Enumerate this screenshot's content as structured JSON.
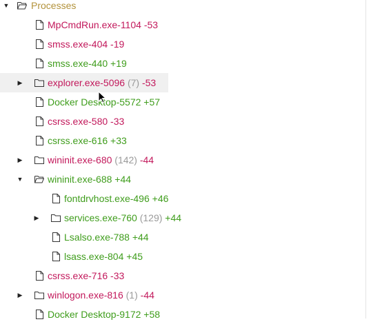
{
  "tree": {
    "root": {
      "label": "Processes",
      "expanded": true
    },
    "rows": [
      {
        "name": "MpCmdRun.exe-1104",
        "count": "",
        "delta": "-53",
        "type": "file",
        "depth": 1,
        "twisty": "",
        "color": "red"
      },
      {
        "name": "smss.exe-404",
        "count": "",
        "delta": "-19",
        "type": "file",
        "depth": 1,
        "twisty": "",
        "color": "red"
      },
      {
        "name": "smss.exe-440",
        "count": "",
        "delta": "+19",
        "type": "file",
        "depth": 1,
        "twisty": "",
        "color": "green"
      },
      {
        "name": "explorer.exe-5096",
        "count": "(7)",
        "delta": "-53",
        "type": "folder",
        "depth": 1,
        "twisty": "collapsed",
        "color": "red",
        "hover": true
      },
      {
        "name": "Docker Desktop-5572",
        "count": "",
        "delta": "+57",
        "type": "file",
        "depth": 1,
        "twisty": "",
        "color": "green"
      },
      {
        "name": "csrss.exe-580",
        "count": "",
        "delta": "-33",
        "type": "file",
        "depth": 1,
        "twisty": "",
        "color": "red"
      },
      {
        "name": "csrss.exe-616",
        "count": "",
        "delta": "+33",
        "type": "file",
        "depth": 1,
        "twisty": "",
        "color": "green"
      },
      {
        "name": "wininit.exe-680",
        "count": "(142)",
        "delta": "-44",
        "type": "folder",
        "depth": 1,
        "twisty": "collapsed",
        "color": "red"
      },
      {
        "name": "wininit.exe-688",
        "count": "",
        "delta": "+44",
        "type": "folder-open",
        "depth": 1,
        "twisty": "expanded",
        "color": "green"
      },
      {
        "name": "fontdrvhost.exe-496",
        "count": "",
        "delta": "+46",
        "type": "file",
        "depth": 2,
        "twisty": "",
        "color": "green"
      },
      {
        "name": "services.exe-760",
        "count": "(129)",
        "delta": "+44",
        "type": "folder",
        "depth": 2,
        "twisty": "collapsed",
        "color": "green"
      },
      {
        "name": "Lsalso.exe-788",
        "count": "",
        "delta": "+44",
        "type": "file",
        "depth": 2,
        "twisty": "",
        "color": "green"
      },
      {
        "name": "lsass.exe-804",
        "count": "",
        "delta": "+45",
        "type": "file",
        "depth": 2,
        "twisty": "",
        "color": "green"
      },
      {
        "name": "csrss.exe-716",
        "count": "",
        "delta": "-33",
        "type": "file",
        "depth": 1,
        "twisty": "",
        "color": "red"
      },
      {
        "name": "winlogon.exe-816",
        "count": "(1)",
        "delta": "-44",
        "type": "folder",
        "depth": 1,
        "twisty": "collapsed",
        "color": "red"
      },
      {
        "name": "Docker Desktop-9172",
        "count": "",
        "delta": "+58",
        "type": "file",
        "depth": 1,
        "twisty": "",
        "color": "green"
      }
    ]
  },
  "colors": {
    "red": "#c2185b",
    "green": "#3f9d1c",
    "count": "#9a9a9a",
    "root": "#b3923a"
  }
}
